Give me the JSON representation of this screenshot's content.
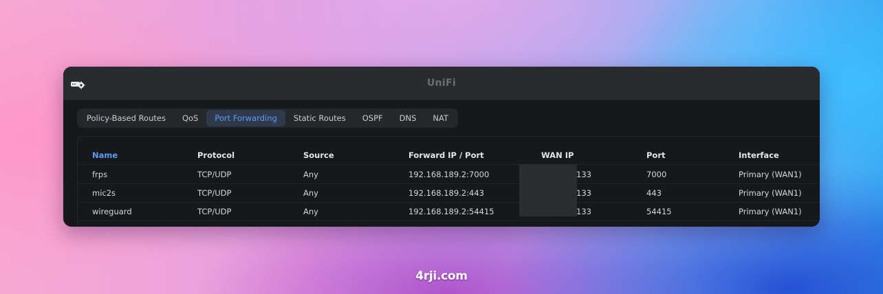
{
  "window": {
    "title": "UniFi"
  },
  "tabs": [
    {
      "label": "Policy-Based Routes",
      "active": false
    },
    {
      "label": "QoS",
      "active": false
    },
    {
      "label": "Port Forwarding",
      "active": true
    },
    {
      "label": "Static Routes",
      "active": false
    },
    {
      "label": "OSPF",
      "active": false
    },
    {
      "label": "DNS",
      "active": false
    },
    {
      "label": "NAT",
      "active": false
    }
  ],
  "table": {
    "columns": [
      "Name",
      "Protocol",
      "Source",
      "Forward IP / Port",
      "WAN IP",
      "Port",
      "Interface"
    ],
    "sorted_column": "Name",
    "rows": [
      {
        "name": "frps",
        "protocol": "TCP/UDP",
        "source": "Any",
        "forward": "192.168.189.2:7000",
        "wan_ip": "133",
        "port": "7000",
        "interface": "Primary (WAN1)"
      },
      {
        "name": "mic2s",
        "protocol": "TCP/UDP",
        "source": "Any",
        "forward": "192.168.189.2:443",
        "wan_ip": "133",
        "port": "443",
        "interface": "Primary (WAN1)"
      },
      {
        "name": "wireguard",
        "protocol": "TCP/UDP",
        "source": "Any",
        "forward": "192.168.189.2:54415",
        "wan_ip": "133",
        "port": "54415",
        "interface": "Primary (WAN1)"
      }
    ]
  },
  "icons": {
    "app": "router-gear-icon"
  },
  "colors": {
    "accent": "#5d9bf0",
    "window_bg": "#17181b",
    "titlebar_bg": "#2a2b2f"
  },
  "watermark": "4rji.com"
}
